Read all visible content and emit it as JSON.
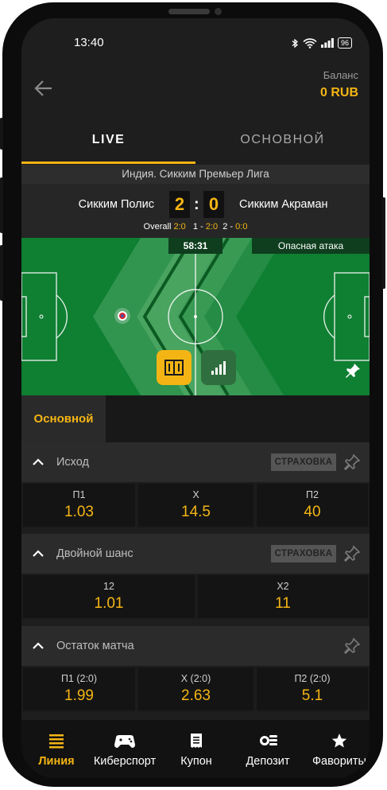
{
  "status_bar": {
    "time": "13:40",
    "battery": "96"
  },
  "header": {
    "balance_label": "Баланс",
    "balance_value": "0 RUB"
  },
  "tabs": [
    {
      "label": "LIVE",
      "active": true
    },
    {
      "label": "ОСНОВНОЙ",
      "active": false
    }
  ],
  "match": {
    "league": "Индия. Сикким Премьер Лига",
    "team_home": "Сикким Полис",
    "team_away": "Сикким Акраман",
    "score_home": "2",
    "score_separator": ":",
    "score_away": "0",
    "overall_label": "Overall",
    "overall_score": "2:0",
    "period1_label": "1 -",
    "period1_score": "2:0",
    "period2_label": "2 -",
    "period2_score": "0:0",
    "timer": "58:31",
    "event": "Опасная атака"
  },
  "subtabs": {
    "active": "Основной"
  },
  "markets": [
    {
      "title": "Исход",
      "insurance_label": "СТРАХОВКА",
      "outcomes": [
        {
          "label": "П1",
          "odds": "1.03"
        },
        {
          "label": "X",
          "odds": "14.5"
        },
        {
          "label": "П2",
          "odds": "40"
        }
      ]
    },
    {
      "title": "Двойной шанс",
      "insurance_label": "СТРАХОВКА",
      "outcomes": [
        {
          "label": "12",
          "odds": "1.01"
        },
        {
          "label": "X2",
          "odds": "11"
        }
      ]
    },
    {
      "title": "Остаток матча",
      "outcomes": [
        {
          "label": "П1 (2:0)",
          "odds": "1.99"
        },
        {
          "label": "X (2:0)",
          "odds": "2.63"
        },
        {
          "label": "П2 (2:0)",
          "odds": "5.1"
        }
      ]
    }
  ],
  "bottom_nav": [
    {
      "label": "Линия",
      "icon": "list-icon",
      "active": true
    },
    {
      "label": "Киберспорт",
      "icon": "gamepad-icon",
      "active": false
    },
    {
      "label": "Купон",
      "icon": "coupon-icon",
      "active": false
    },
    {
      "label": "Депозит",
      "icon": "coins-icon",
      "active": false
    },
    {
      "label": "Фавориты",
      "icon": "star-icon",
      "active": false
    }
  ],
  "colors": {
    "accent": "#f4b514",
    "background": "#1e1e1e",
    "field": "#0f7f32"
  }
}
